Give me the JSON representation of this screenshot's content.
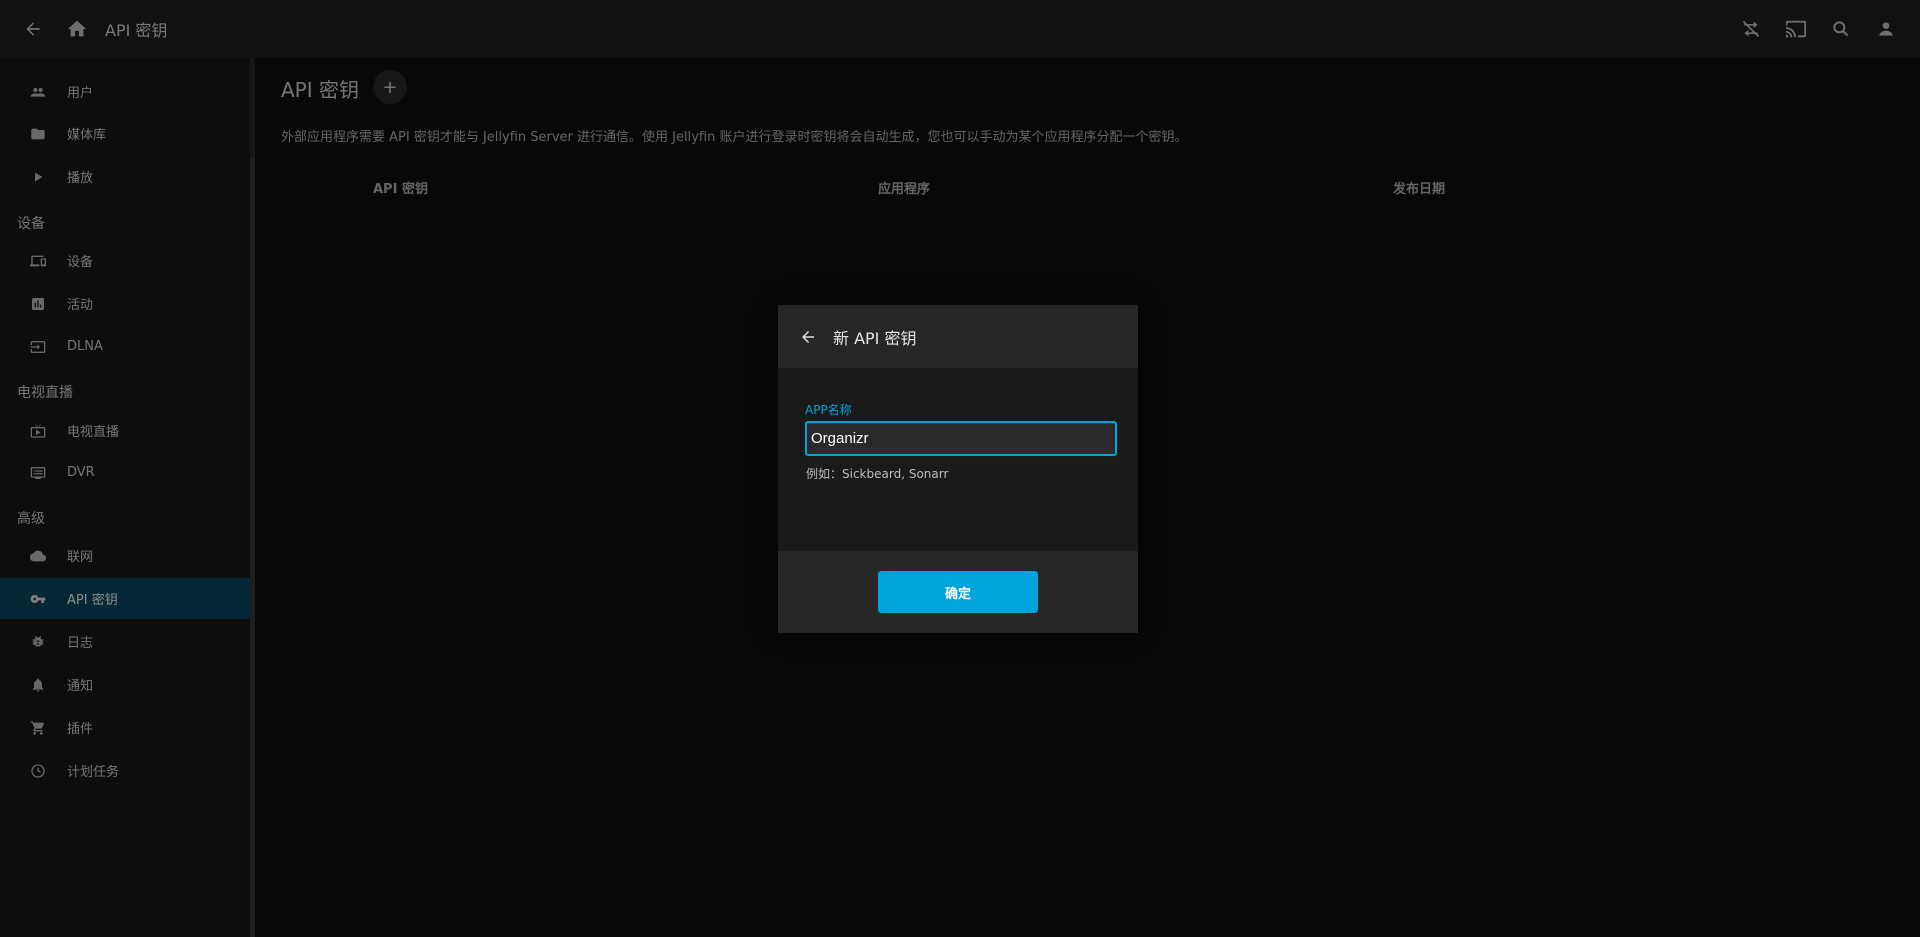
{
  "header": {
    "title": "API 密钥",
    "icons": [
      "back-arrow-icon",
      "home-icon",
      "sync-play-icon",
      "cast-icon",
      "search-icon",
      "user-icon"
    ]
  },
  "sidebar": {
    "items": [
      {
        "label": "用户",
        "icon": "users-icon"
      },
      {
        "label": "媒体库",
        "icon": "folder-icon"
      },
      {
        "label": "播放",
        "icon": "play-icon"
      },
      {
        "label": "设备",
        "icon": "devices-icon"
      },
      {
        "label": "活动",
        "icon": "activity-icon"
      },
      {
        "label": "DLNA",
        "icon": "input-icon"
      },
      {
        "label": "电视直播",
        "icon": "live-tv-icon"
      },
      {
        "label": "DVR",
        "icon": "dvr-icon"
      },
      {
        "label": "联网",
        "icon": "cloud-icon"
      },
      {
        "label": "API 密钥",
        "icon": "key-icon"
      },
      {
        "label": "日志",
        "icon": "bug-icon"
      },
      {
        "label": "通知",
        "icon": "bell-icon"
      },
      {
        "label": "插件",
        "icon": "cart-icon"
      },
      {
        "label": "计划任务",
        "icon": "clock-icon"
      }
    ],
    "headings": [
      "设备",
      "电视直播",
      "高级"
    ],
    "active_index": 9
  },
  "main": {
    "title": "API 密钥",
    "add_label": "+",
    "description": "外部应用程序需要 API 密钥才能与 Jellyfin Server 进行通信。使用 Jellyfin 账户进行登录时密钥将会自动生成，您也可以手动为某个应用程序分配一个密钥。",
    "columns": [
      "API 密钥",
      "应用程序",
      "发布日期"
    ]
  },
  "dialog": {
    "title": "新 API 密钥",
    "field_label": "APP名称",
    "field_value": "Organizr",
    "field_help": "例如：Sickbeard, Sonarr",
    "ok_label": "确定"
  },
  "colors": {
    "accent": "#00a4dc",
    "active_item": "#0b4a63"
  }
}
